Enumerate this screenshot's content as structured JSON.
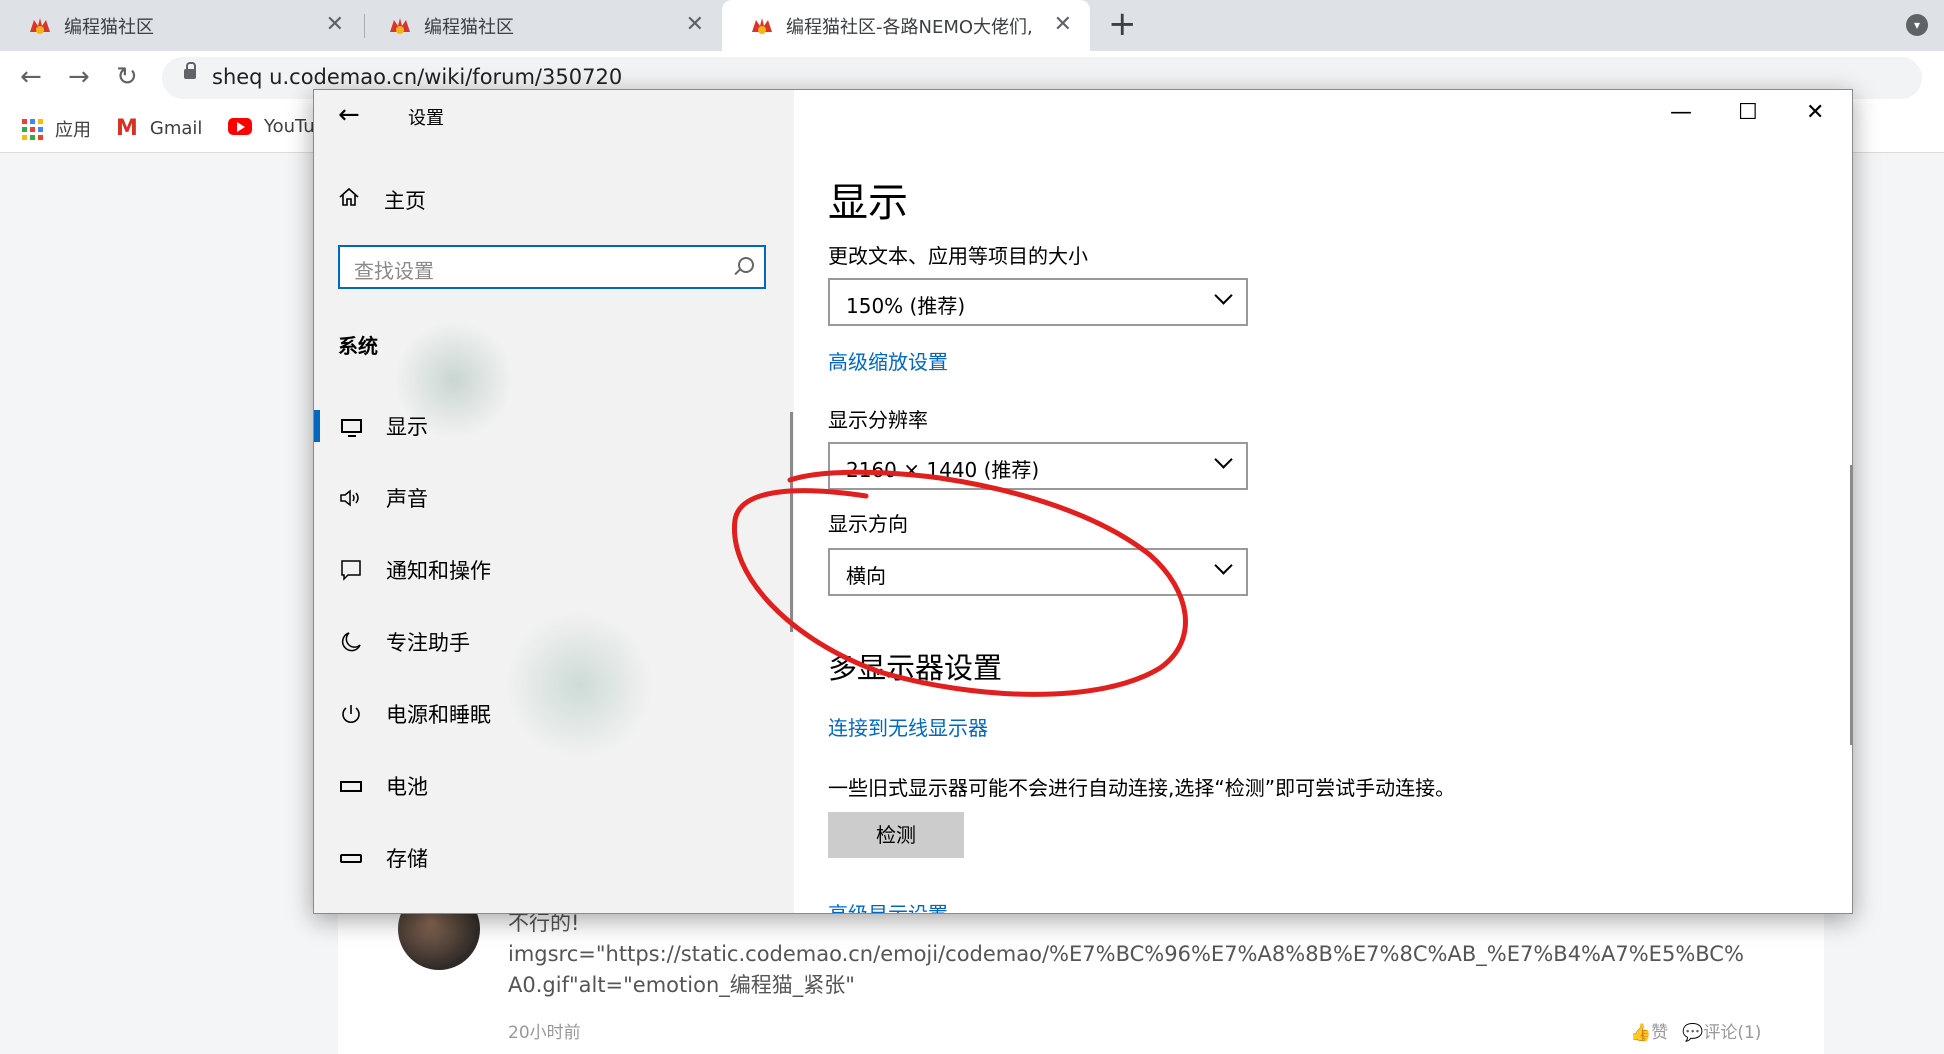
{
  "browser": {
    "tabs": [
      {
        "title": "编程猫社区",
        "active": false
      },
      {
        "title": "编程猫社区",
        "active": false
      },
      {
        "title": "编程猫社区-各路NEMO大佬们,",
        "active": true
      }
    ],
    "close_glyph": "✕",
    "new_tab_glyph": "+",
    "url": "sheq u.codemao.cn/wiki/forum/350720",
    "bookmarks": [
      {
        "label": "应用",
        "icon": "apps-grid-icon"
      },
      {
        "label": "Gmail",
        "icon": "gmail-icon"
      },
      {
        "label": "YouTu",
        "icon": "youtube-icon"
      }
    ]
  },
  "settings": {
    "window_title": "设置",
    "home_label": "主页",
    "search_placeholder": "查找设置",
    "section_title": "系统",
    "nav": [
      {
        "label": "显示",
        "icon": "monitor-icon",
        "selected": true
      },
      {
        "label": "声音",
        "icon": "speaker-icon",
        "selected": false
      },
      {
        "label": "通知和操作",
        "icon": "notification-icon",
        "selected": false
      },
      {
        "label": "专注助手",
        "icon": "moon-icon",
        "selected": false
      },
      {
        "label": "电源和睡眠",
        "icon": "power-icon",
        "selected": false
      },
      {
        "label": "电池",
        "icon": "battery-icon",
        "selected": false
      },
      {
        "label": "存储",
        "icon": "storage-icon",
        "selected": false
      }
    ],
    "page_title": "显示",
    "scale_label": "更改文本、应用等项目的大小",
    "scale_value": "150% (推荐)",
    "advanced_scale_link": "高级缩放设置",
    "resolution_label": "显示分辨率",
    "resolution_value": "2160 × 1440 (推荐)",
    "orientation_label": "显示方向",
    "orientation_value": "横向",
    "multi_display_title": "多显示器设置",
    "wireless_link": "连接到无线显示器",
    "legacy_text": "一些旧式显示器可能不会进行自动连接,选择“检测”即可尝试手动连接。",
    "detect_button": "检测",
    "advanced_display_link": "高级显示设置"
  },
  "page": {
    "comment_text_1": "不行的!",
    "comment_text_2": "imgsrc=\"https://static.codemao.cn/emoji/codemao/%E7%BC%96%E7%A8%8B%E7%8C%AB_%E7%B4%A7%E5%BC%A0.gif\"alt=\"emotion_编程猫_紧张\"",
    "comment_time": "20小时前",
    "like_label": "赞",
    "comment_label": "评论(1)"
  },
  "colors": {
    "accent": "#0067c0",
    "annotation": "#e0201f"
  }
}
